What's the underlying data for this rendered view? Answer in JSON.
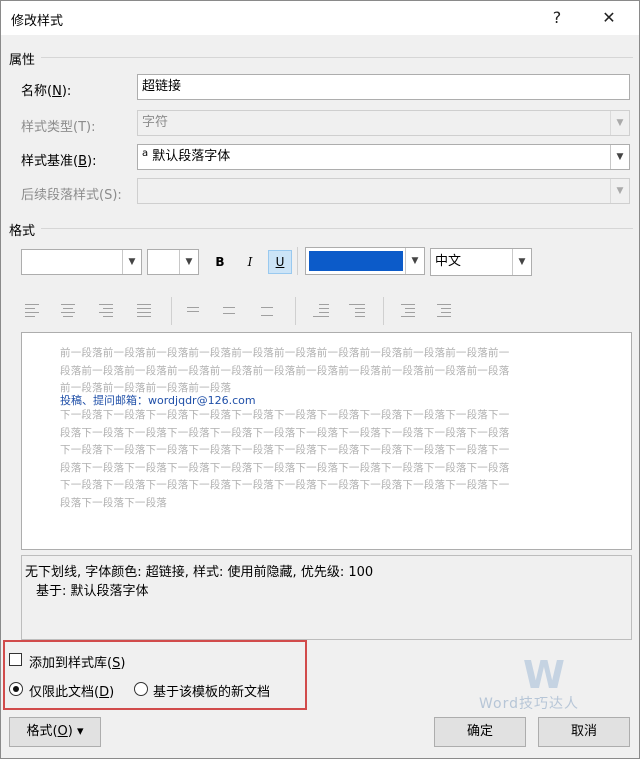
{
  "window": {
    "title": "修改样式",
    "help_label": "?",
    "close_label": "✕"
  },
  "properties": {
    "section_label": "属性",
    "name": {
      "label_pre": "名称(",
      "key": "N",
      "label_post": "):",
      "value": "超链接"
    },
    "style_type": {
      "label": "样式类型(T):",
      "value": "字符"
    },
    "based_on": {
      "label_pre": "样式基准(",
      "key": "B",
      "label_post": "):",
      "icon_glyph": "a",
      "value": "默认段落字体"
    },
    "following": {
      "label": "后续段落样式(S):",
      "value": ""
    }
  },
  "format": {
    "section_label": "格式",
    "font": "",
    "size": "",
    "bold": "B",
    "italic": "I",
    "underline": "U",
    "font_color": "#0c5bc9",
    "script": "中文"
  },
  "preview": {
    "prev_lines": [
      "前一段落前一段落前一段落前一段落前一段落前一段落前一段落前一段落前一段落前一段落前一",
      "段落前一段落前一段落前一段落前一段落前一段落前一段落前一段落前一段落前一段落前一段落",
      "前一段落前一段落前一段落前一段落"
    ],
    "sample": "投稿、提问邮箱：wordjqdr@126.com",
    "next_lines": [
      "下一段落下一段落下一段落下一段落下一段落下一段落下一段落下一段落下一段落下一段落下一",
      "段落下一段落下一段落下一段落下一段落下一段落下一段落下一段落下一段落下一段落下一段落",
      "下一段落下一段落下一段落下一段落下一段落下一段落下一段落下一段落下一段落下一段落下一",
      "段落下一段落下一段落下一段落下一段落下一段落下一段落下一段落下一段落下一段落下一段落",
      "下一段落下一段落下一段落下一段落下一段落下一段落下一段落下一段落下一段落下一段落下一",
      "段落下一段落下一段落"
    ]
  },
  "description": {
    "line1": "无下划线, 字体颜色: 超链接, 样式: 使用前隐藏, 优先级: 100",
    "line2": "基于: 默认段落字体"
  },
  "options": {
    "add_to_gallery": {
      "label_pre": "添加到样式库(",
      "key": "S",
      "label_post": ")",
      "checked": false
    },
    "this_document": {
      "label_pre": "仅限此文档(",
      "key": "D",
      "label_post": ")",
      "selected": true
    },
    "new_documents": {
      "label": "基于该模板的新文档",
      "selected": false
    }
  },
  "buttons": {
    "format_pre": "格式(",
    "format_key": "O",
    "format_post": ")",
    "format_arrow": "▾",
    "ok": "确定",
    "cancel": "取消"
  },
  "watermark": {
    "logo_letter": "W",
    "text": "Word技巧达人"
  }
}
